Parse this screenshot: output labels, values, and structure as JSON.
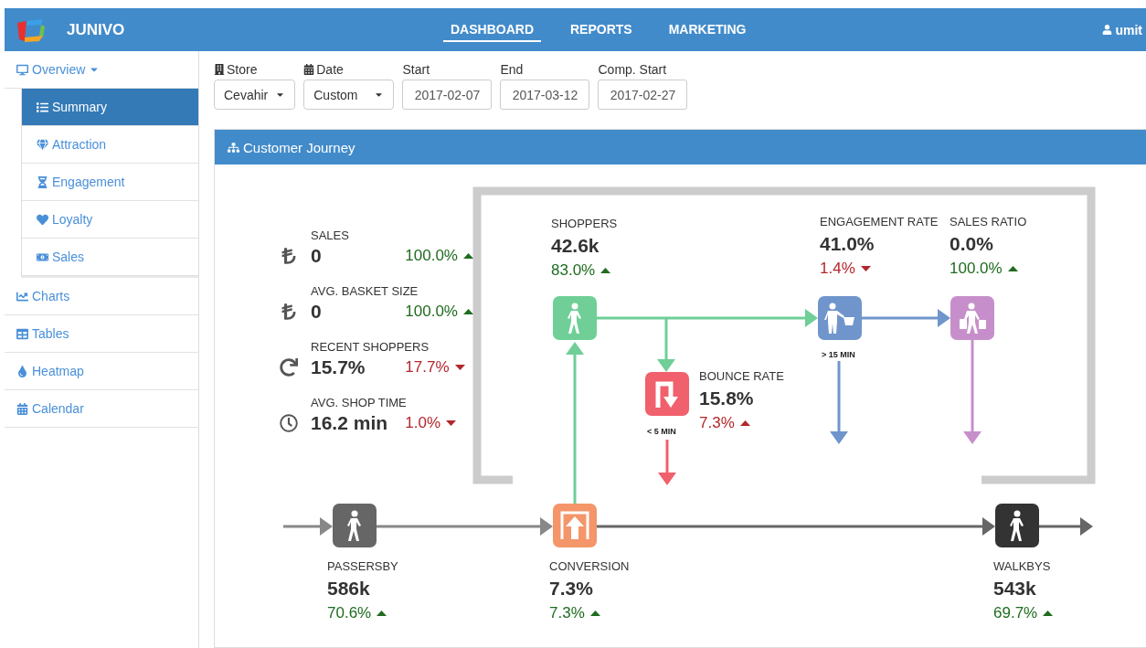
{
  "navbar": {
    "brand": "JUNIVO",
    "links": [
      {
        "label": "DASHBOARD",
        "selected": true
      },
      {
        "label": "REPORTS",
        "selected": false
      },
      {
        "label": "MARKETING",
        "selected": false
      }
    ],
    "user": "umit"
  },
  "sidebar": {
    "items": [
      {
        "label": "Overview",
        "expanded": true,
        "children": [
          {
            "label": "Summary",
            "selected": true
          },
          {
            "label": "Attraction",
            "selected": false
          },
          {
            "label": "Engagement",
            "selected": false
          },
          {
            "label": "Loyalty",
            "selected": false
          },
          {
            "label": "Sales",
            "selected": false
          }
        ]
      },
      {
        "label": "Charts"
      },
      {
        "label": "Tables"
      },
      {
        "label": "Heatmap"
      },
      {
        "label": "Calendar"
      }
    ]
  },
  "filters": {
    "store": {
      "label": "Store",
      "value": "Cevahir"
    },
    "date": {
      "label": "Date",
      "value": "Custom"
    },
    "fields": [
      {
        "label": "Start",
        "value": "2017-02-07"
      },
      {
        "label": "End",
        "value": "2017-03-12"
      },
      {
        "label": "Comp. Start",
        "value": "2017-02-27"
      }
    ]
  },
  "panel": {
    "title": "Customer Journey",
    "summary_metrics": [
      {
        "label": "SALES",
        "value": "0",
        "change": "100.0%",
        "rising": true,
        "positive": true
      },
      {
        "label": "AVG. BASKET SIZE",
        "value": "0",
        "change": "100.0%",
        "rising": true,
        "positive": true
      },
      {
        "label": "RECENT SHOPPERS",
        "value": "15.7%",
        "change": "17.7%",
        "rising": false,
        "positive": false
      },
      {
        "label": "AVG. SHOP TIME",
        "value": "16.2 min",
        "change": "1.0%",
        "rising": false,
        "positive": false
      }
    ],
    "stages": {
      "shoppers": {
        "label": "SHOPPERS",
        "value": "42.6k",
        "change": "83.0%",
        "rising": true,
        "positive": true,
        "color": "#6fcf97"
      },
      "bounce": {
        "label": "BOUNCE RATE",
        "value": "15.8%",
        "change": "7.3%",
        "rising": true,
        "positive": false,
        "color": "#f0606d",
        "note": "< 5 MIN"
      },
      "engagement": {
        "label": "ENGAGEMENT RATE",
        "value": "41.0%",
        "change": "1.4%",
        "rising": false,
        "positive": false,
        "color": "#6f95cc",
        "note": "> 15 MIN"
      },
      "sales_ratio": {
        "label": "SALES RATIO",
        "value": "0.0%",
        "change": "100.0%",
        "rising": true,
        "positive": true,
        "color": "#c68fcb"
      },
      "passersby": {
        "label": "PASSERSBY",
        "value": "586k",
        "change": "70.6%",
        "rising": true,
        "positive": true,
        "color": "#666666"
      },
      "conversion": {
        "label": "CONVERSION",
        "value": "7.3%",
        "change": "7.3%",
        "rising": true,
        "positive": true,
        "color": "#f4956a"
      },
      "walkbys": {
        "label": "WALKBYS",
        "value": "543k",
        "change": "69.7%",
        "rising": true,
        "positive": true,
        "color": "#333333"
      }
    }
  }
}
